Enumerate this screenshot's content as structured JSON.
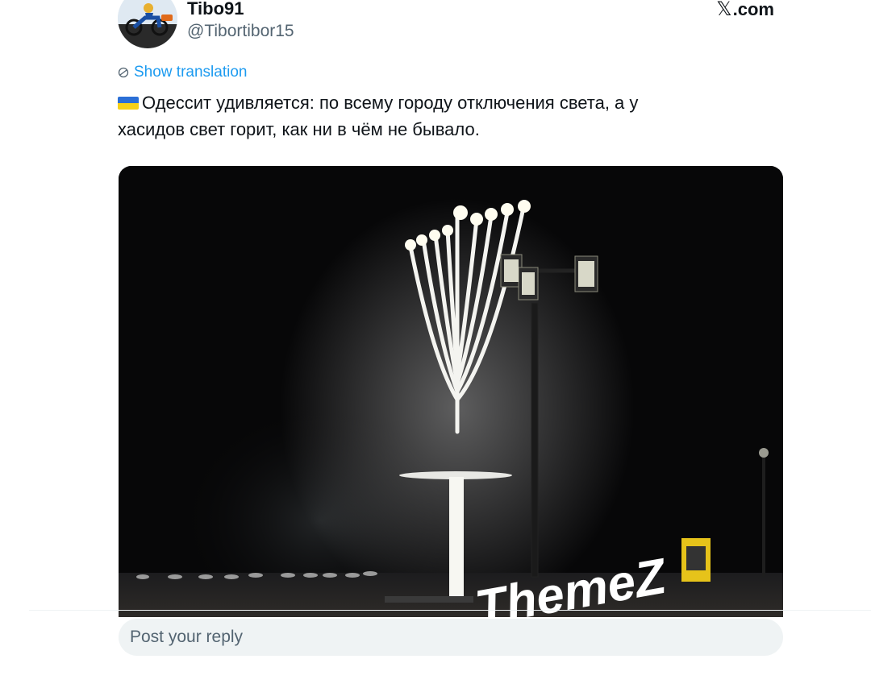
{
  "tweet": {
    "author": {
      "display_name": "Tibo91",
      "handle": "@Tibortibor15",
      "avatar_icon": "avatar-motorcycle-image"
    },
    "site_label": ".com",
    "site_logo": "x-logo-icon",
    "show_translation_label": "Show translation",
    "flag_icon": "ukraine-flag-icon",
    "text_line1": "Одессит удивляется: по всему городу отключения света, а у",
    "text_line2": "хасидов свет горит, как ни в чём не бывало.",
    "media": {
      "watermark": "ThemeZ",
      "description_icon": "video-thumbnail-menorah"
    }
  },
  "reply": {
    "placeholder": "Post your reply"
  },
  "colors": {
    "text": "#0f1419",
    "secondary": "#536471",
    "link": "#1d9bf0",
    "reply_bg": "#eff3f4",
    "media_bg": "#060607"
  }
}
